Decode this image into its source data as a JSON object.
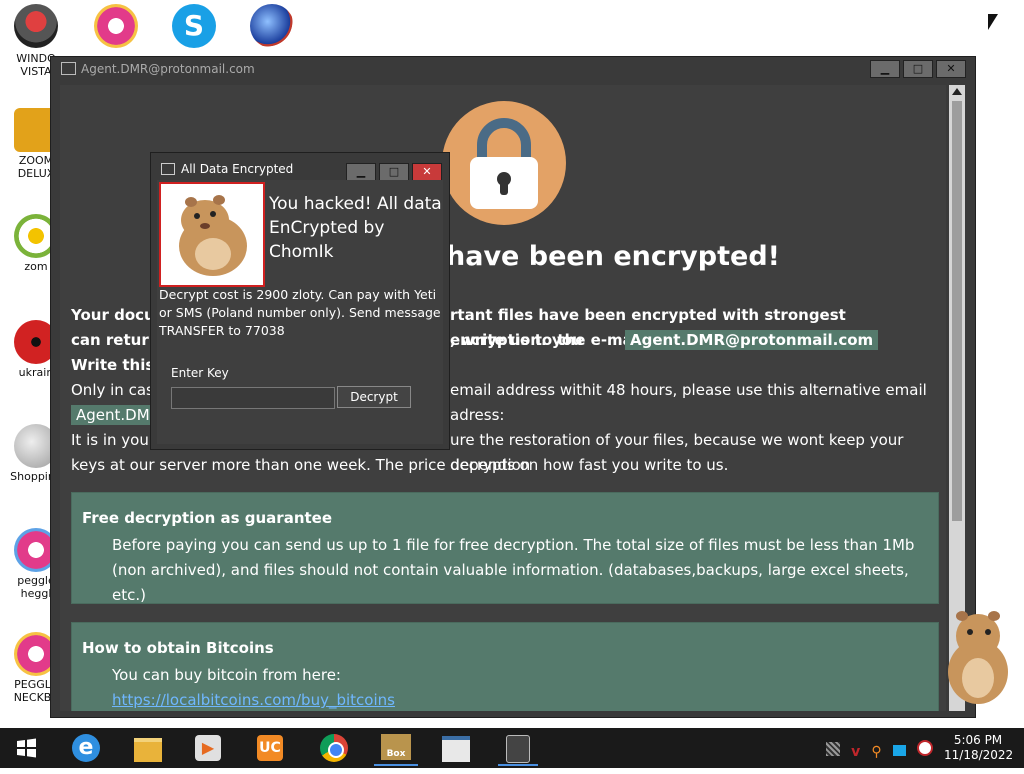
{
  "desktop": {
    "icons": [
      {
        "label": "WINDO\nVISTA"
      },
      {
        "label": ""
      },
      {
        "label": ""
      },
      {
        "label": ""
      },
      {
        "label": "ZOOM\nDELUX"
      },
      {
        "label": "zom"
      },
      {
        "label": "ukrain"
      },
      {
        "label": "Shopping"
      },
      {
        "label": "peggle\nheggl"
      },
      {
        "label": "PEGGLE\nNECKBE"
      }
    ]
  },
  "main_window": {
    "title": "Agent.DMR@protonmail.com",
    "headline": "have been encrypted!",
    "para1_a": "Your docu",
    "para1_b": "rtant files have been encrypted with strongest encryption. you",
    "para1_c": "can return",
    "para1_d": ", write us to the e-mail:",
    "email_highlight": "Agent.DMR@protonmail.com",
    "para1_e": "Write this",
    "para2_a": "Only in case",
    "para2_b": "email address withit 48 hours, please use this alternative email adress:",
    "alt_email": "Agent.DMR",
    "para3_a": "It is in your",
    "para3_b": "ure the restoration of your files, because we wont keep your decryption",
    "para3_c": "keys at our server more than one week. The price depends on how fast you write to us.",
    "free_title": "Free decryption as guarantee",
    "free_text": "Before paying you can send us up to 1 file for free decryption. The total size of files must be less than 1Mb (non archived), and files should not contain valuable information. (databases,backups, large excel sheets, etc.)",
    "bitcoin_title": "How to obtain Bitcoins",
    "bitcoin_text": "You can buy bitcoin from here:",
    "bitcoin_link": "https://localbitcoins.com/buy_bitcoins"
  },
  "dialog": {
    "title": "All Data Encrypted",
    "heading": "You hacked! All data EnCrypted by ChomIk",
    "description": "Decrypt cost is 2900 zloty. Can pay with Yeti or SMS (Poland number only). Send message TRANSFER to 77038",
    "key_label": "Enter Key",
    "key_value": "",
    "decrypt_label": "Decrypt"
  },
  "taskbar": {
    "time": "5:06 PM",
    "date": "11/18/2022",
    "box_label": "Box"
  },
  "colors": {
    "window_bg": "#3f3f3f",
    "highlight_green": "#557a6c",
    "lock_orange": "#e3a266",
    "link_blue": "#6fb7ff"
  }
}
